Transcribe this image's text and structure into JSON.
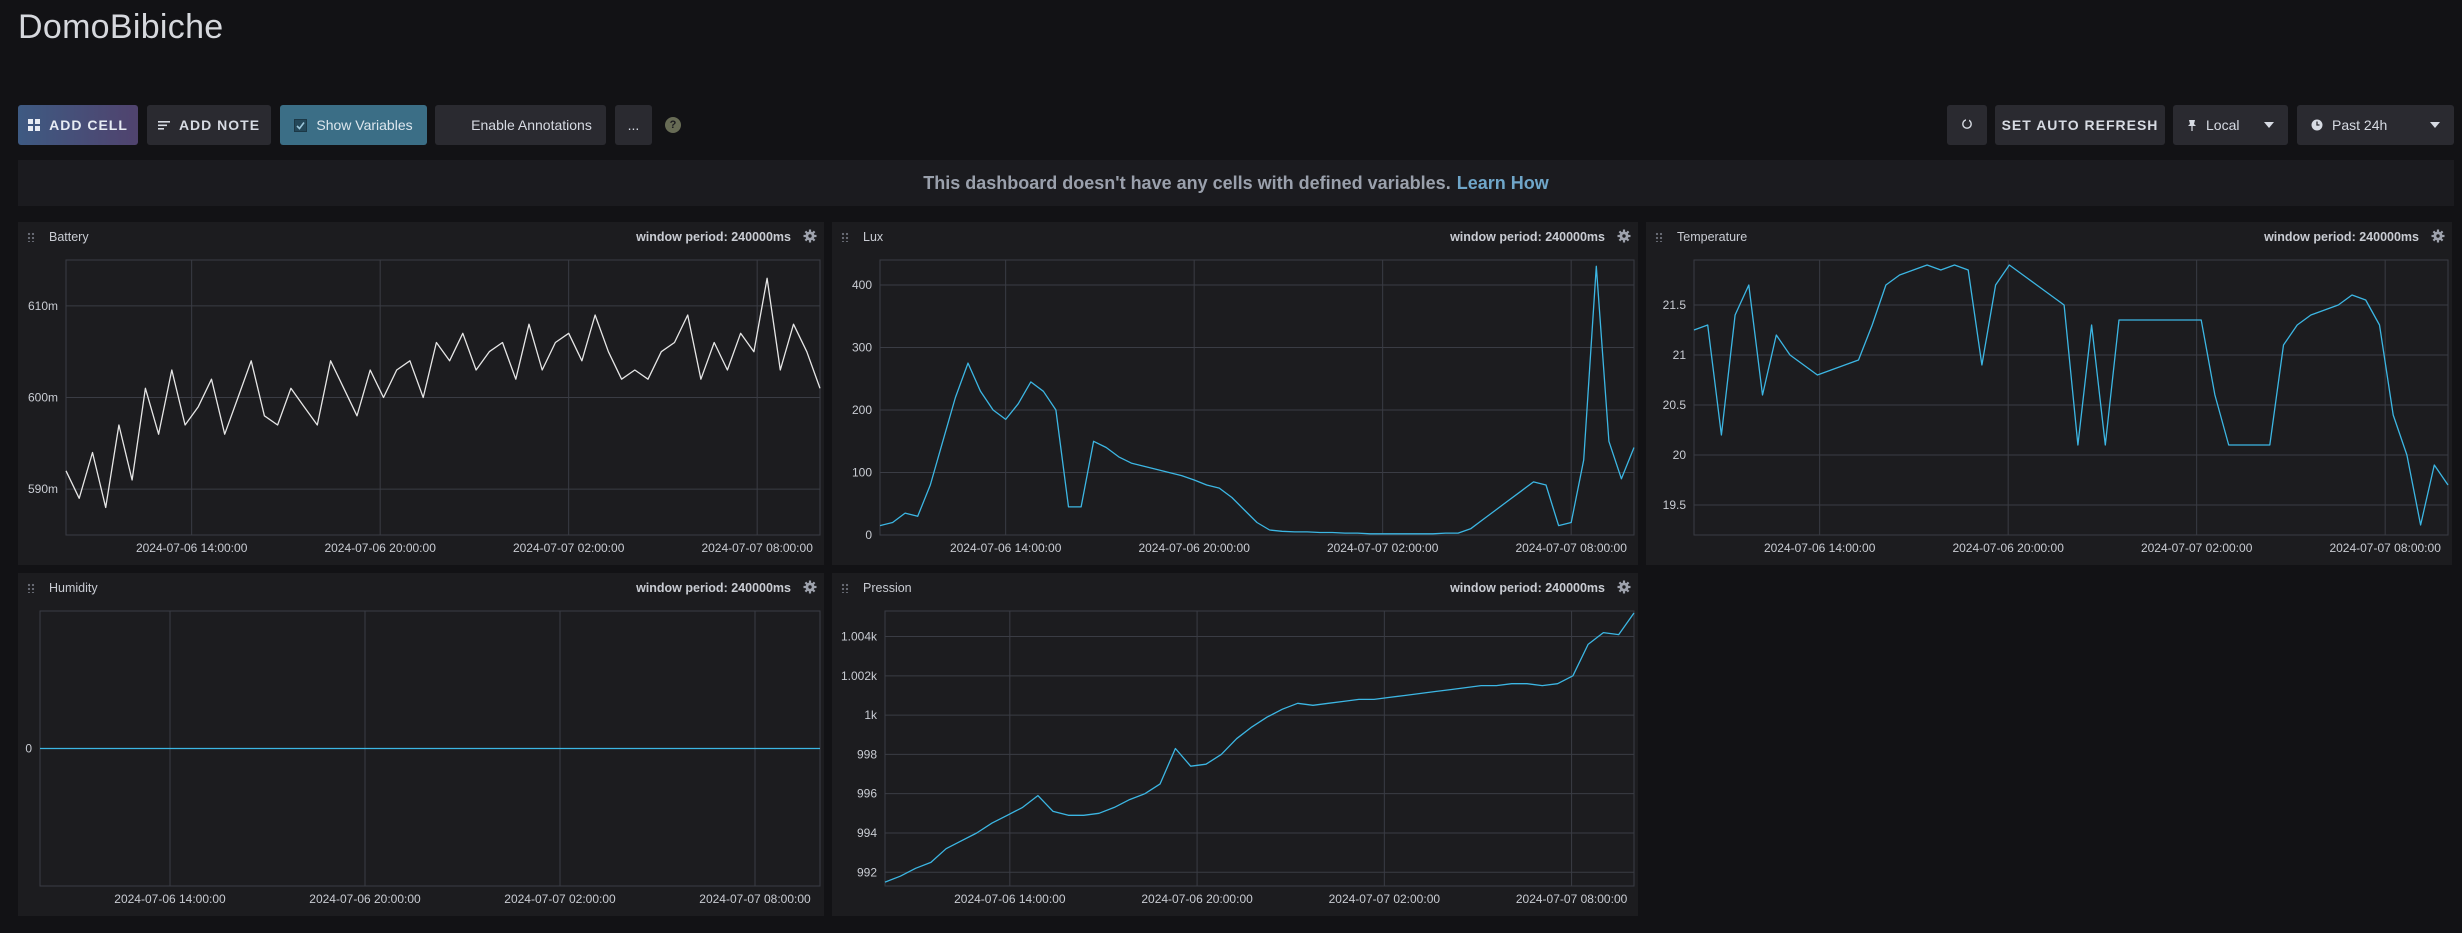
{
  "dashboard": {
    "title": "DomoBibiche"
  },
  "toolbar": {
    "add_cell": "ADD CELL",
    "add_note": "ADD NOTE",
    "show_variables": "Show Variables",
    "enable_annotations": "Enable Annotations",
    "more": "...",
    "help": "?",
    "auto_refresh": "SET AUTO REFRESH",
    "timezone": "Local",
    "time_range": "Past 24h"
  },
  "notice": {
    "text": "This dashboard doesn't have any cells with defined variables.",
    "link": "Learn How"
  },
  "colors": {
    "line_blue": "#3cb6e3",
    "line_white": "#e6e6e6",
    "accent": "#3b6e86"
  },
  "x_ticks": [
    "2024-07-06 14:00:00",
    "2024-07-06 20:00:00",
    "2024-07-07 02:00:00",
    "2024-07-07 08:00:00"
  ],
  "cells": [
    {
      "name": "Battery",
      "window": "window period: 240000ms"
    },
    {
      "name": "Lux",
      "window": "window period: 240000ms"
    },
    {
      "name": "Temperature",
      "window": "window period: 240000ms"
    },
    {
      "name": "Humidity",
      "window": "window period: 240000ms"
    },
    {
      "name": "Pression",
      "window": "window period: 240000ms"
    }
  ],
  "chart_data": [
    {
      "type": "line",
      "series": [
        {
          "values": [
            592,
            589,
            594,
            588,
            597,
            591,
            601,
            596,
            603,
            597,
            599,
            602,
            596,
            600,
            604,
            598,
            597,
            601,
            599,
            597,
            604,
            601,
            598,
            603,
            600,
            603,
            604,
            600,
            606,
            604,
            607,
            603,
            605,
            606,
            602,
            608,
            603,
            606,
            607,
            604,
            609,
            605,
            602,
            603,
            602,
            605,
            606,
            609,
            602,
            606,
            603,
            607,
            605,
            613,
            603,
            608,
            605,
            601
          ]
        }
      ],
      "x_range": [
        "2024-07-06 10:00:00",
        "2024-07-07 10:00:00"
      ],
      "x_tick_labels": [
        "2024-07-06 14:00:00",
        "2024-07-06 20:00:00",
        "2024-07-07 02:00:00",
        "2024-07-07 08:00:00"
      ],
      "y_ticks": [
        {
          "v": 590,
          "label": "590m"
        },
        {
          "v": 600,
          "label": "600m"
        },
        {
          "v": 610,
          "label": "610m"
        }
      ],
      "ylim": [
        585,
        615
      ],
      "color": "#e6e6e6",
      "grid": true
    },
    {
      "type": "line",
      "series": [
        {
          "values": [
            15,
            20,
            35,
            30,
            80,
            150,
            220,
            275,
            230,
            200,
            185,
            210,
            245,
            230,
            200,
            45,
            45,
            150,
            140,
            125,
            115,
            110,
            105,
            100,
            95,
            88,
            80,
            75,
            60,
            40,
            20,
            8,
            6,
            5,
            5,
            4,
            4,
            3,
            3,
            2,
            2,
            2,
            2,
            2,
            2,
            3,
            3,
            10,
            25,
            40,
            55,
            70,
            85,
            80,
            15,
            20,
            120,
            430,
            150,
            90,
            140
          ]
        }
      ],
      "x_range": [
        "2024-07-06 10:00:00",
        "2024-07-07 10:00:00"
      ],
      "x_tick_labels": [
        "2024-07-06 14:00:00",
        "2024-07-06 20:00:00",
        "2024-07-07 02:00:00",
        "2024-07-07 08:00:00"
      ],
      "y_ticks": [
        {
          "v": 0,
          "label": "0"
        },
        {
          "v": 100,
          "label": "100"
        },
        {
          "v": 200,
          "label": "200"
        },
        {
          "v": 300,
          "label": "300"
        },
        {
          "v": 400,
          "label": "400"
        }
      ],
      "ylim": [
        0,
        440
      ],
      "color": "#3cb6e3",
      "grid": true
    },
    {
      "type": "line",
      "series": [
        {
          "values": [
            21.25,
            21.3,
            20.2,
            21.4,
            21.7,
            20.6,
            21.2,
            21.0,
            20.9,
            20.8,
            20.85,
            20.9,
            20.95,
            21.3,
            21.7,
            21.8,
            21.85,
            21.9,
            21.85,
            21.9,
            21.85,
            20.9,
            21.7,
            21.9,
            21.8,
            21.7,
            21.6,
            21.5,
            20.1,
            21.3,
            20.1,
            21.35,
            21.35,
            21.35,
            21.35,
            21.35,
            21.35,
            21.35,
            20.6,
            20.1,
            20.1,
            20.1,
            20.1,
            21.1,
            21.3,
            21.4,
            21.45,
            21.5,
            21.6,
            21.55,
            21.3,
            20.4,
            20.0,
            19.3,
            19.9,
            19.7
          ]
        }
      ],
      "x_range": [
        "2024-07-06 10:00:00",
        "2024-07-07 10:00:00"
      ],
      "x_tick_labels": [
        "2024-07-06 14:00:00",
        "2024-07-06 20:00:00",
        "2024-07-07 02:00:00",
        "2024-07-07 08:00:00"
      ],
      "y_ticks": [
        {
          "v": 19.5,
          "label": "19.5"
        },
        {
          "v": 20,
          "label": "20"
        },
        {
          "v": 20.5,
          "label": "20.5"
        },
        {
          "v": 21,
          "label": "21"
        },
        {
          "v": 21.5,
          "label": "21.5"
        }
      ],
      "ylim": [
        19.2,
        21.95
      ],
      "color": "#3cb6e3",
      "grid": true
    },
    {
      "type": "line",
      "series": [
        {
          "values": [
            0,
            0
          ]
        }
      ],
      "x_range": [
        "2024-07-06 10:00:00",
        "2024-07-07 10:00:00"
      ],
      "x_tick_labels": [
        "2024-07-06 14:00:00",
        "2024-07-06 20:00:00",
        "2024-07-07 02:00:00",
        "2024-07-07 08:00:00"
      ],
      "y_ticks": [
        {
          "v": 0,
          "label": "0"
        }
      ],
      "ylim": [
        -1,
        1
      ],
      "color": "#3cb6e3",
      "grid": true
    },
    {
      "type": "line",
      "series": [
        {
          "values": [
            991.5,
            991.8,
            992.2,
            992.5,
            993.2,
            993.6,
            994.0,
            994.5,
            994.9,
            995.3,
            995.9,
            995.1,
            994.9,
            994.9,
            995.0,
            995.3,
            995.7,
            996.0,
            996.5,
            998.3,
            997.4,
            997.5,
            998.0,
            998.8,
            999.4,
            999.9,
            1000.3,
            1000.6,
            1000.5,
            1000.6,
            1000.7,
            1000.8,
            1000.8,
            1000.9,
            1001.0,
            1001.1,
            1001.2,
            1001.3,
            1001.4,
            1001.5,
            1001.5,
            1001.6,
            1001.6,
            1001.5,
            1001.6,
            1002.0,
            1003.6,
            1004.2,
            1004.1,
            1005.2
          ]
        }
      ],
      "x_range": [
        "2024-07-06 10:00:00",
        "2024-07-07 10:00:00"
      ],
      "x_tick_labels": [
        "2024-07-06 14:00:00",
        "2024-07-06 20:00:00",
        "2024-07-07 02:00:00",
        "2024-07-07 08:00:00"
      ],
      "y_ticks": [
        {
          "v": 992,
          "label": "992"
        },
        {
          "v": 994,
          "label": "994"
        },
        {
          "v": 996,
          "label": "996"
        },
        {
          "v": 998,
          "label": "998"
        },
        {
          "v": 1000,
          "label": "1k"
        },
        {
          "v": 1002,
          "label": "1.002k"
        },
        {
          "v": 1004,
          "label": "1.004k"
        }
      ],
      "ylim": [
        991.3,
        1005.3
      ],
      "color": "#3cb6e3",
      "grid": true
    }
  ]
}
